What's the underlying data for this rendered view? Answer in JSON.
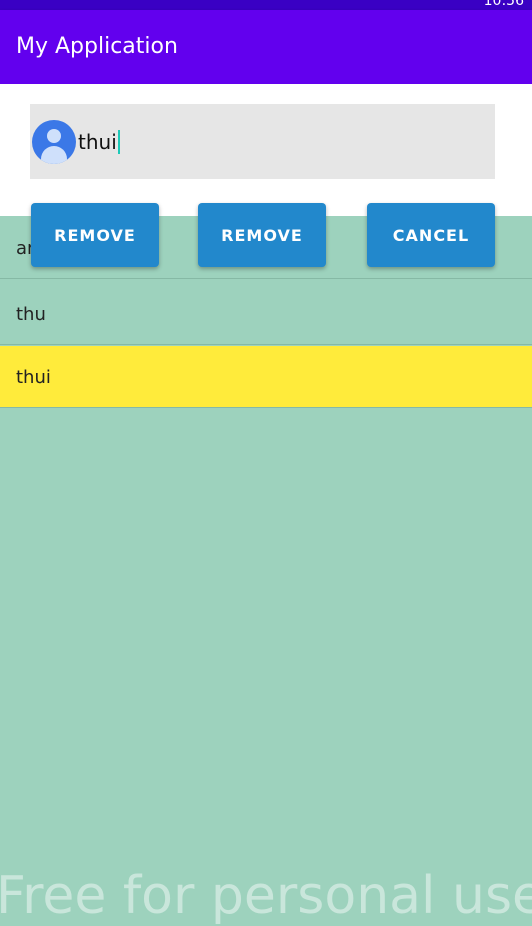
{
  "status_bar": {
    "time": "10:56"
  },
  "app_bar": {
    "title": "My Application"
  },
  "search": {
    "value": "thui"
  },
  "buttons": {
    "remove_1": "REMOVE",
    "remove_2": "REMOVE",
    "cancel": "CANCEL"
  },
  "list": {
    "items": [
      {
        "label": "an",
        "selected": false
      },
      {
        "label": "thu",
        "selected": false
      },
      {
        "label": "thui",
        "selected": true
      }
    ]
  },
  "watermark": "Free for personal use",
  "colors": {
    "app_bar": "#6200ee",
    "status_bar": "#3a00c4",
    "background": "#9dd2bd",
    "selected_row": "#ffeb3b",
    "button": "#2288cc",
    "avatar": "#3b78e7"
  }
}
